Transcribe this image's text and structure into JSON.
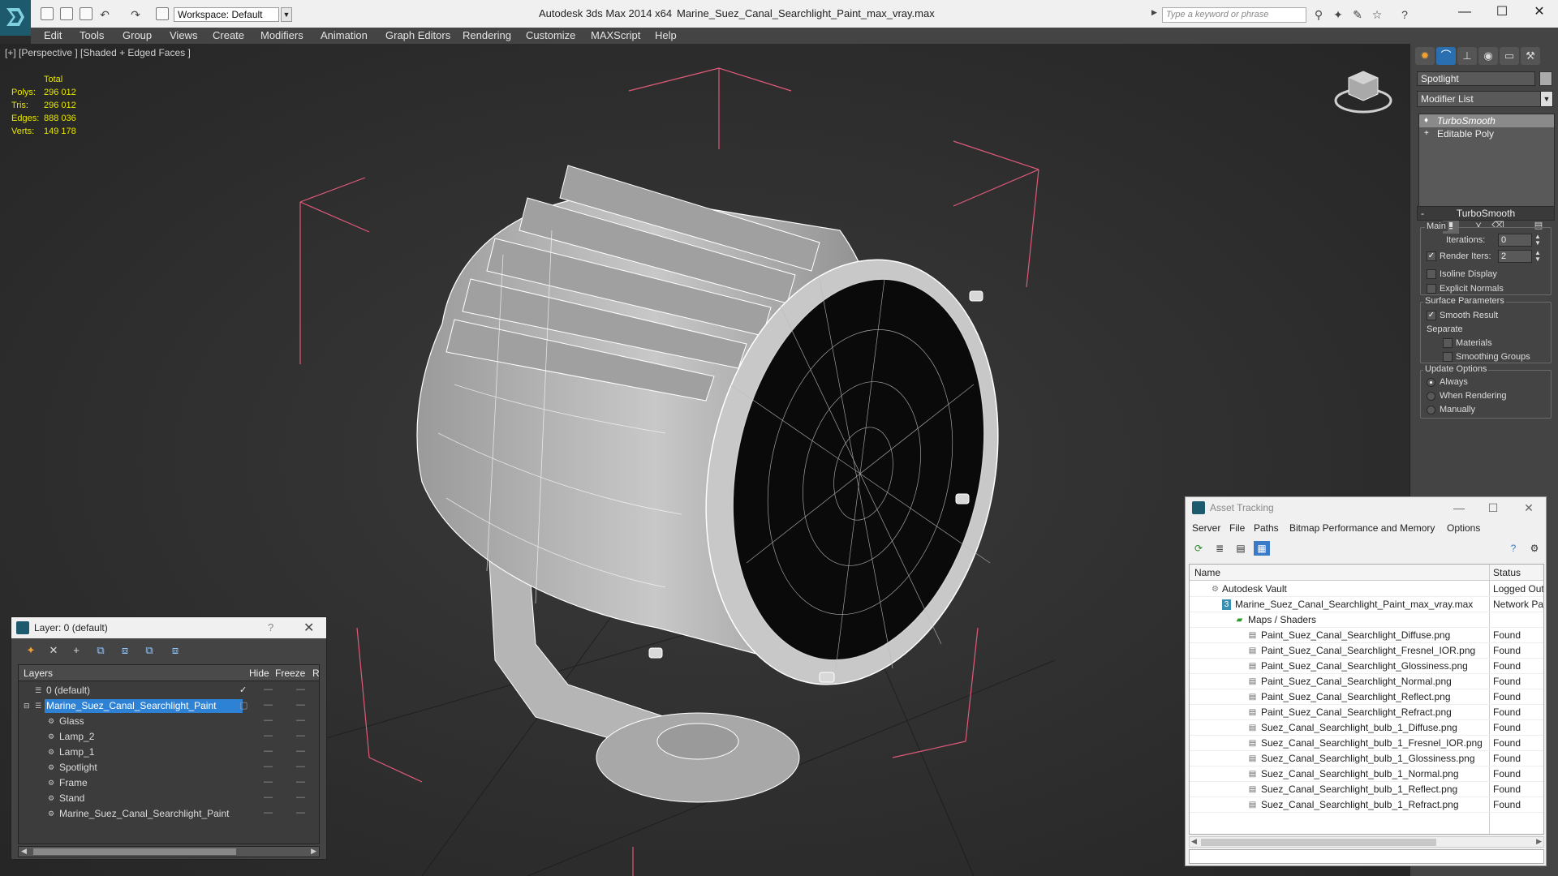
{
  "title": {
    "app": "Autodesk 3ds Max  2014 x64",
    "file": "Marine_Suez_Canal_Searchlight_Paint_max_vray.max",
    "workspace": "Workspace: Default",
    "search_placeholder": "Type a keyword or phrase"
  },
  "menu": [
    "Edit",
    "Tools",
    "Group",
    "Views",
    "Create",
    "Modifiers",
    "Animation",
    "Graph Editors",
    "Rendering",
    "Customize",
    "MAXScript",
    "Help"
  ],
  "viewport": {
    "label": "[+] [Perspective ] [Shaded + Edged Faces ]",
    "stats": {
      "header": "Total",
      "rows": [
        {
          "label": "Polys:",
          "value": "296 012"
        },
        {
          "label": "Tris:",
          "value": "296 012"
        },
        {
          "label": "Edges:",
          "value": "888 036"
        },
        {
          "label": "Verts:",
          "value": "149 178"
        }
      ]
    }
  },
  "command_panel": {
    "object_name": "Spotlight",
    "modifier_list": "Modifier List",
    "stack": [
      "TurboSmooth",
      "Editable Poly"
    ],
    "rollout": "TurboSmooth",
    "main_group": "Main",
    "iterations_label": "Iterations:",
    "iterations_value": "0",
    "render_iters_label": "Render Iters:",
    "render_iters_value": "2",
    "isoline": "Isoline Display",
    "explicit_normals": "Explicit Normals",
    "surface_group": "Surface Parameters",
    "smooth_result": "Smooth Result",
    "separate": "Separate",
    "materials": "Materials",
    "smoothing_groups": "Smoothing Groups",
    "update_group": "Update Options",
    "always": "Always",
    "when_rendering": "When Rendering",
    "manually": "Manually"
  },
  "layer_panel": {
    "title": "Layer: 0 (default)",
    "help": "?",
    "columns": [
      "Layers",
      "Hide",
      "Freeze",
      "R"
    ],
    "rows": [
      {
        "name": "0 (default)"
      },
      {
        "name": "Marine_Suez_Canal_Searchlight_Paint"
      },
      {
        "name": "Glass"
      },
      {
        "name": "Lamp_2"
      },
      {
        "name": "Lamp_1"
      },
      {
        "name": "Spotlight"
      },
      {
        "name": "Frame"
      },
      {
        "name": "Stand"
      },
      {
        "name": "Marine_Suez_Canal_Searchlight_Paint"
      }
    ]
  },
  "asset_panel": {
    "title": "Asset Tracking",
    "menu": [
      "Server",
      "File",
      "Paths",
      "Bitmap Performance and Memory",
      "Options"
    ],
    "columns": [
      "Name",
      "Status"
    ],
    "rows": [
      {
        "name": "Autodesk Vault",
        "status": "Logged Out"
      },
      {
        "name": "Marine_Suez_Canal_Searchlight_Paint_max_vray.max",
        "status": "Network Pa"
      },
      {
        "name": "Maps / Shaders",
        "status": ""
      },
      {
        "name": "Paint_Suez_Canal_Searchlight_Diffuse.png",
        "status": "Found"
      },
      {
        "name": "Paint_Suez_Canal_Searchlight_Fresnel_IOR.png",
        "status": "Found"
      },
      {
        "name": "Paint_Suez_Canal_Searchlight_Glossiness.png",
        "status": "Found"
      },
      {
        "name": "Paint_Suez_Canal_Searchlight_Normal.png",
        "status": "Found"
      },
      {
        "name": "Paint_Suez_Canal_Searchlight_Reflect.png",
        "status": "Found"
      },
      {
        "name": "Paint_Suez_Canal_Searchlight_Refract.png",
        "status": "Found"
      },
      {
        "name": "Suez_Canal_Searchlight_bulb_1_Diffuse.png",
        "status": "Found"
      },
      {
        "name": "Suez_Canal_Searchlight_bulb_1_Fresnel_IOR.png",
        "status": "Found"
      },
      {
        "name": "Suez_Canal_Searchlight_bulb_1_Glossiness.png",
        "status": "Found"
      },
      {
        "name": "Suez_Canal_Searchlight_bulb_1_Normal.png",
        "status": "Found"
      },
      {
        "name": "Suez_Canal_Searchlight_bulb_1_Reflect.png",
        "status": "Found"
      },
      {
        "name": "Suez_Canal_Searchlight_bulb_1_Refract.png",
        "status": "Found"
      }
    ]
  },
  "colors": {
    "selection": "#2e82d6",
    "stats_text": "#e8e600",
    "bbox_lines": "#e05a7a"
  }
}
